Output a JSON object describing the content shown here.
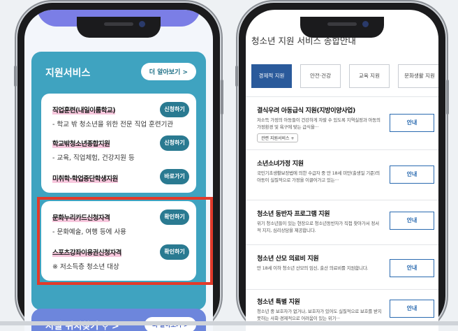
{
  "left": {
    "support_title": "지원서비스",
    "support_more": "더 알아보기 >",
    "items": [
      {
        "name": "직업훈련(내일이룸학교)",
        "btn": "신청하기",
        "desc": "- 학교 밖 청소년을 위한 전문 직업 훈련기관"
      },
      {
        "name": "학교밖청소년종합지원",
        "btn": "신청하기",
        "desc": "- 교육, 직업체험, 건강지원 등"
      },
      {
        "name": "미취학·학업중단학생지원",
        "btn": "바로가기",
        "desc": ""
      },
      {
        "name": "문화누리카드신청자격",
        "btn": "확인하기",
        "desc": "- 문화예술, 여행 등에 사용"
      },
      {
        "name": "스포츠강좌이용권신청자격",
        "btn": "확인하기",
        "desc": "※ 저소득층 청소년 대상"
      }
    ],
    "facility_title": "시설 위치찾기 ⚲ >",
    "facility_more": "더 알아보기 >"
  },
  "right": {
    "page_title": "청소년 지원 서비스 종합안내",
    "tabs": [
      "경제적 지원",
      "안전·건강",
      "교육 지원",
      "문화생활 지원"
    ],
    "services": [
      {
        "title": "결식우려 아동급식 지원(지방이양사업)",
        "desc": "저소득 가정의 아동들이 건강하게 자랄 수 있도록 지역실정과 아동의 가정환경 및 욕구에 맞는 급식을···",
        "tag": "관련 지원서비스 +",
        "btn": "안내"
      },
      {
        "title": "소년소녀가정 지원",
        "desc": "국민기초생활보장법에 의한 수급자 중 만 18세 미만(출생일 기준)의 아동이 실질적으로 가정을 이끌어가고 있는···",
        "tag": "",
        "btn": "안내"
      },
      {
        "title": "청소년 동반자 프로그램 지원",
        "desc": "위기 청소년들이 있는 현장으로 청소년동반자가 직접 찾아가서 정서적 지지, 심리상담을 제공합니다.",
        "tag": "",
        "btn": "안내"
      },
      {
        "title": "청소년 산모 의료비 지원",
        "desc": "만 18세 이하 청소년 산모의 임신, 출산 의료비를 지원합니다.",
        "tag": "",
        "btn": "안내"
      },
      {
        "title": "청소년 특별 지원",
        "desc": "청소년 중 보호자가 없거나, 보호자가 있어도 실질적으로 보호를 받지 못하는 사회·경제적으로 어려움이 있는 위기···",
        "tag": "",
        "btn": "안내"
      }
    ]
  },
  "colors": {
    "accent": "#3fa3c0",
    "highlight_box": "#e33a2a",
    "tab_active": "#2a5a9b"
  }
}
